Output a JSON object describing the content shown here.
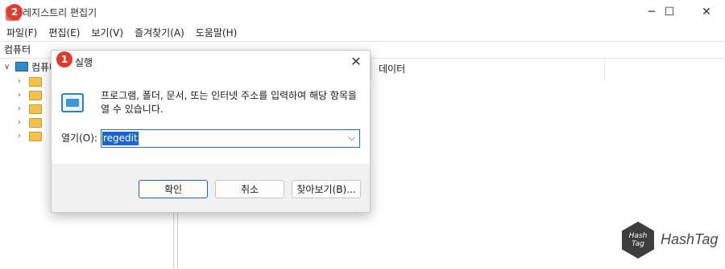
{
  "window": {
    "title": "레지스트리 편집기"
  },
  "menu": [
    "파일(F)",
    "편집(E)",
    "보기(V)",
    "즐겨찾기(A)",
    "도움말(H)"
  ],
  "address": "컴퓨터",
  "tree": {
    "root_label": "컴퓨터"
  },
  "list": {
    "columns": [
      "데이터"
    ]
  },
  "run_dialog": {
    "title": "실행",
    "description": "프로그램, 폴더, 문서, 또는 인터넷 주소를 입력하여 해당 항목을 열 수 있습니다.",
    "open_label": "열기(O):",
    "open_value": "regedit",
    "ok": "확인",
    "cancel": "취소",
    "browse": "찾아보기(B)..."
  },
  "badges": [
    "1",
    "2"
  ],
  "watermark": {
    "cube_line1": "Hash",
    "cube_line2": "Tag",
    "text": "HashTag"
  },
  "colors": {
    "badge": "#e23a2e",
    "selection": "#1a64d6"
  }
}
